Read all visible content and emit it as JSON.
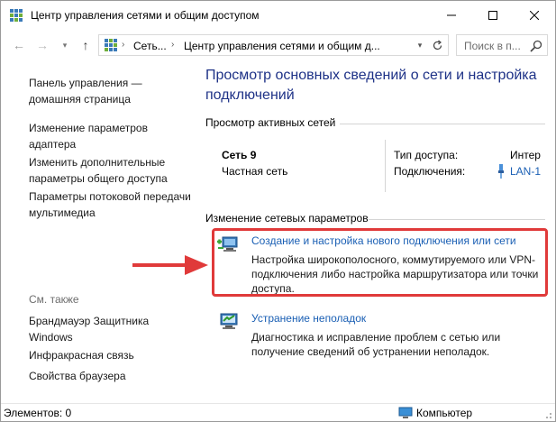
{
  "window": {
    "title": "Центр управления сетями и общим доступом",
    "icon": "network-center-icon"
  },
  "address": {
    "crumbs": [
      "Сеть...",
      "Центр управления сетями и общим д..."
    ],
    "search_placeholder": "Поиск в п..."
  },
  "left_pane": {
    "links": [
      {
        "label": "Панель управления — домашняя страница"
      },
      {
        "label": "Изменение параметров адаптера"
      },
      {
        "label": "Изменить дополнительные параметры общего доступа"
      },
      {
        "label": "Параметры потоковой передачи мультимедиа"
      }
    ],
    "see_also_label": "См. также",
    "see_also_links": [
      {
        "label": "Брандмауэр Защитника Windows"
      },
      {
        "label": "Инфракрасная связь"
      },
      {
        "label": "Свойства браузера"
      }
    ]
  },
  "main": {
    "heading": "Просмотр основных сведений о сети и настройка подключений",
    "active_networks_title": "Просмотр активных сетей",
    "network": {
      "name": "Сеть 9",
      "category": "Частная сеть",
      "access_type_label": "Тип доступа:",
      "access_type_value": "Интер",
      "connections_label": "Подключения:",
      "connections_value": "LAN-1"
    },
    "change_settings_title": "Изменение сетевых параметров",
    "tasks": [
      {
        "title": "Создание и настройка нового подключения или сети",
        "description": "Настройка широкополосного, коммутируемого или VPN-подключения либо настройка маршрутизатора или точки доступа.",
        "icon": "new-connection-icon"
      },
      {
        "title": "Устранение неполадок",
        "description": "Диагностика и исправление проблем с сетью или получение сведений об устранении неполадок.",
        "icon": "troubleshoot-icon"
      }
    ]
  },
  "status_bar": {
    "items_text": "Элементов: 0",
    "computer_text": "Компьютер"
  },
  "colors": {
    "heading": "#1e3287",
    "link": "#1a5fb4",
    "highlight": "#e03a3a"
  }
}
